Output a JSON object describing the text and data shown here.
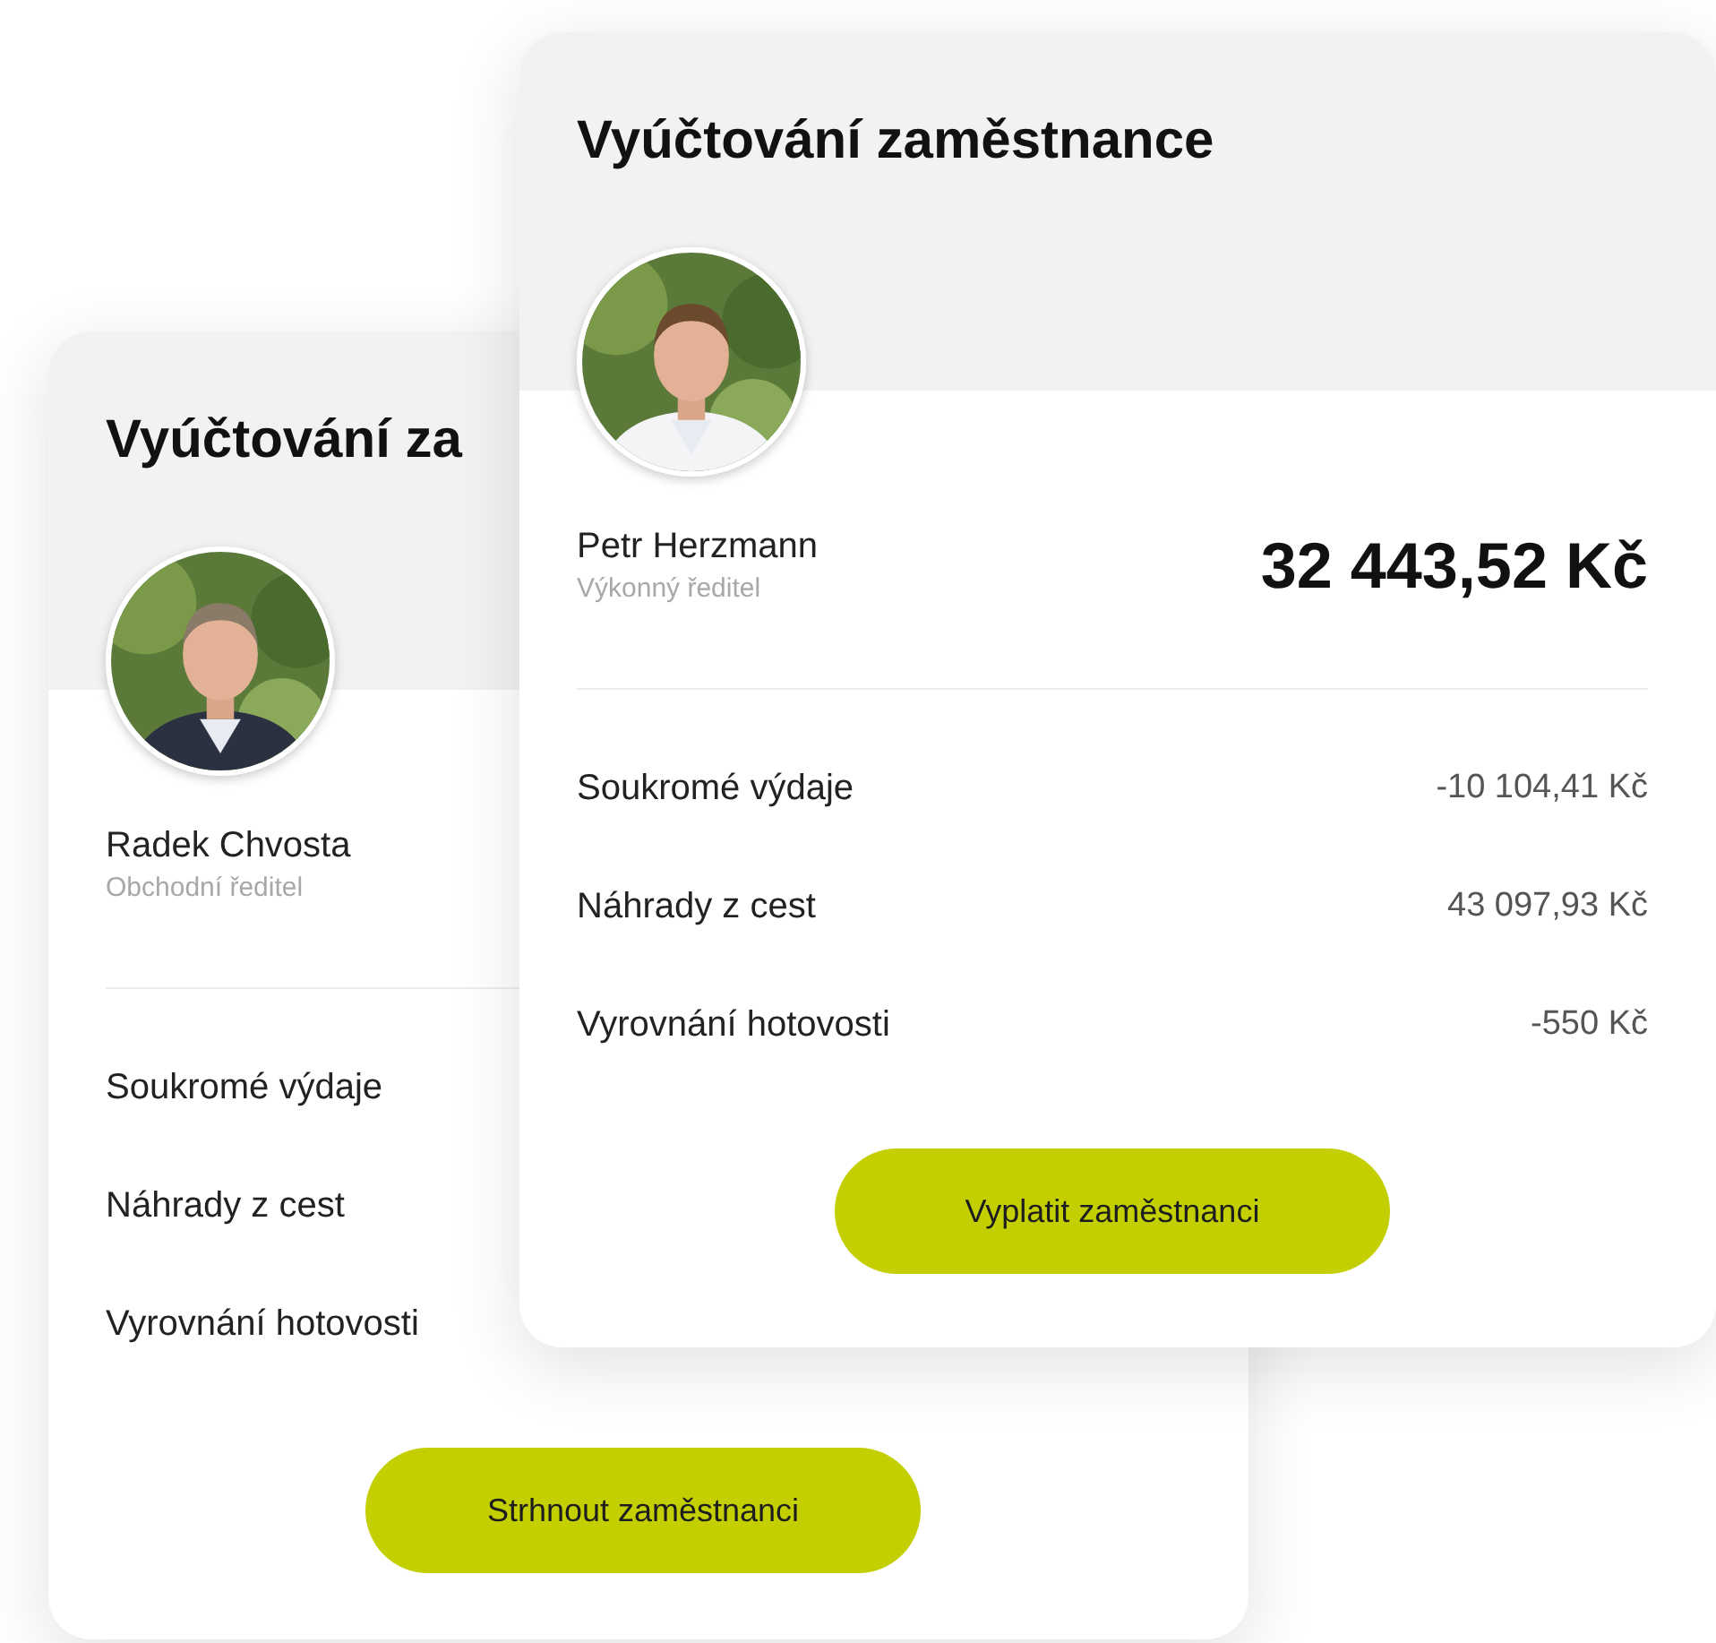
{
  "cards": [
    {
      "title": "Vyúčtování za",
      "employee": {
        "name": "Radek Chvosta",
        "role": "Obchodní ředitel"
      },
      "rows": [
        {
          "label": "Soukromé výdaje"
        },
        {
          "label": "Náhrady z cest"
        },
        {
          "label": "Vyrovnání hotovosti"
        }
      ],
      "button": "Strhnout zaměstnanci"
    },
    {
      "title": "Vyúčtování zaměstnance",
      "employee": {
        "name": "Petr Herzmann",
        "role": "Výkonný ředitel"
      },
      "total": "32 443,52 Kč",
      "rows": [
        {
          "label": "Soukromé výdaje",
          "value": "-10 104,41 Kč"
        },
        {
          "label": "Náhrady z cest",
          "value": "43 097,93 Kč"
        },
        {
          "label": "Vyrovnání hotovosti",
          "value": "-550 Kč"
        }
      ],
      "button": "Vyplatit zaměstnanci"
    }
  ]
}
